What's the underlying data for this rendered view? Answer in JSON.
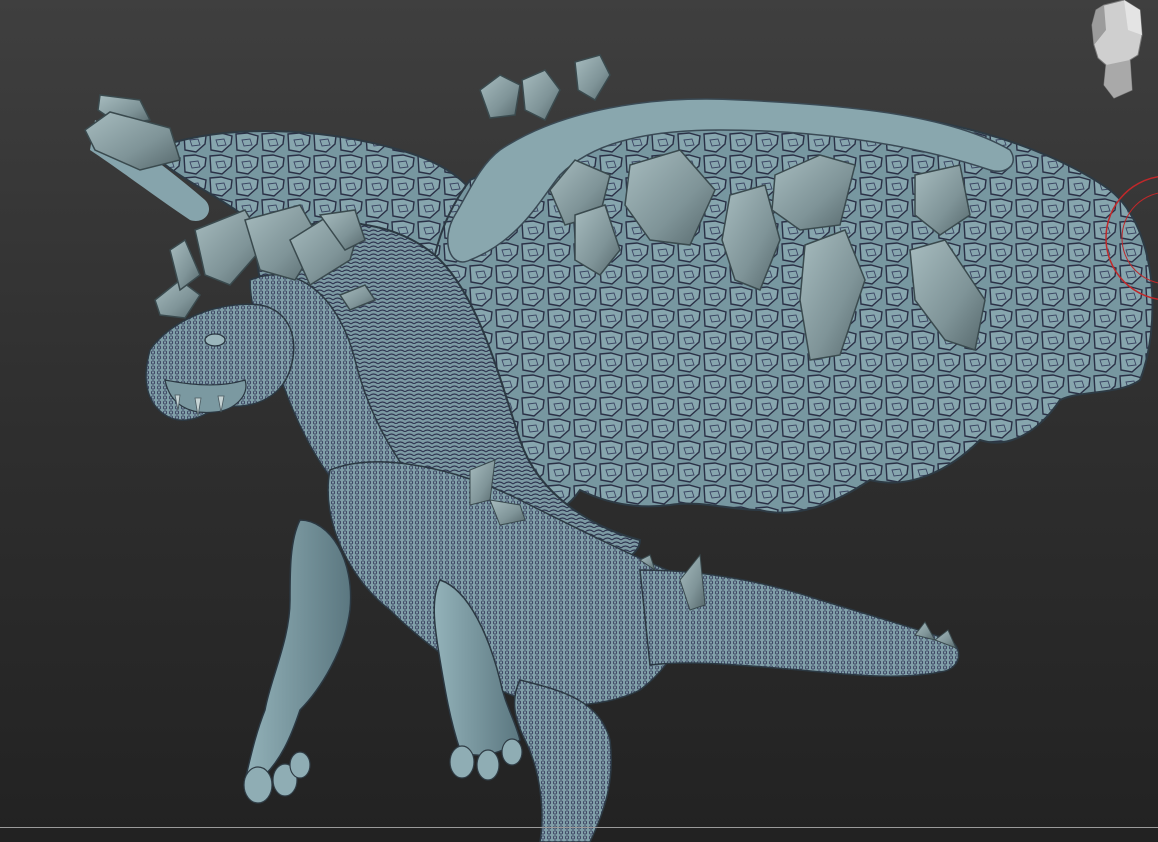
{
  "app": {
    "canvas_subject": "dragon-sculpt",
    "navigation_widget": "head-orientation-icon",
    "gizmo": "rotation-gizmo-icon"
  },
  "colors": {
    "background_top": "#3f3f3f",
    "background_bottom": "#222222",
    "model_base": "#7f9ea6",
    "model_highlight": "#a9c3c8",
    "model_shadow": "#2e3d48",
    "scale_texture": "#3a3f5c",
    "crystal": "#8fa5a9",
    "gizmo_ring": "#c0282a",
    "floor_line": "#9a9a9a"
  }
}
